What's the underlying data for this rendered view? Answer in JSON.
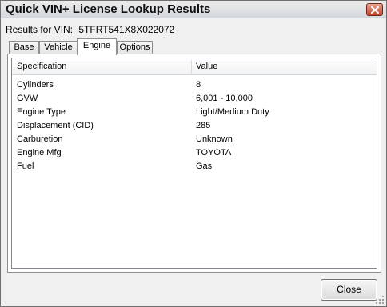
{
  "window": {
    "title": "Quick VIN+ License Lookup Results"
  },
  "results": {
    "label": "Results for VIN:",
    "vin": "5TFRT541X8X022072"
  },
  "tabs": [
    {
      "label": "Base",
      "active": false
    },
    {
      "label": "Vehicle",
      "active": false
    },
    {
      "label": "Engine",
      "active": true
    },
    {
      "label": "Options",
      "active": false
    }
  ],
  "table": {
    "columns": [
      "Specification",
      "Value"
    ],
    "rows": [
      {
        "spec": "Cylinders",
        "value": "8"
      },
      {
        "spec": "GVW",
        "value": "6,001 - 10,000"
      },
      {
        "spec": "Engine Type",
        "value": "Light/Medium Duty"
      },
      {
        "spec": "Displacement (CID)",
        "value": "285"
      },
      {
        "spec": "Carburetion",
        "value": "Unknown"
      },
      {
        "spec": "Engine Mfg",
        "value": "TOYOTA"
      },
      {
        "spec": "Fuel",
        "value": "Gas"
      }
    ]
  },
  "buttons": {
    "close_label": "Close"
  },
  "icons": {
    "title_close": "close-icon",
    "resize": "resize-grip-icon"
  },
  "colors": {
    "title_close_bg": "#c6412a",
    "window_bg": "#f0f0f0"
  }
}
